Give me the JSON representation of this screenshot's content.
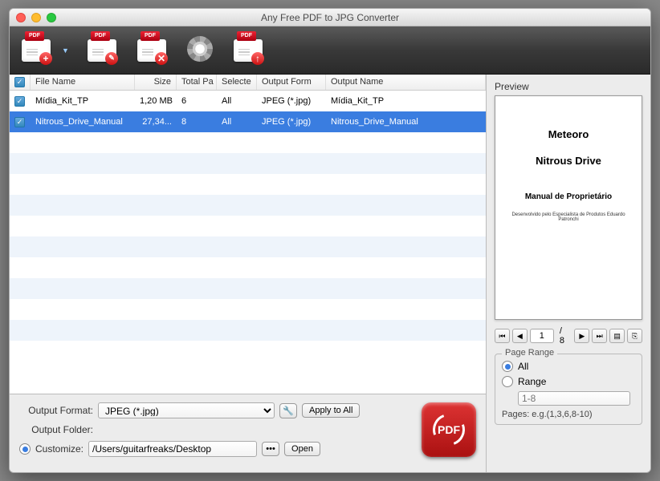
{
  "window": {
    "title": "Any Free PDF to JPG Converter"
  },
  "toolbar": {
    "add_label": "Add PDF",
    "edit_label": "Edit PDF",
    "remove_label": "Remove PDF",
    "settings_label": "Settings",
    "upload_label": "Upload PDF"
  },
  "columns": {
    "file_name": "File Name",
    "size": "Size",
    "total_pages": "Total Pa",
    "selected": "Selecte",
    "output_format": "Output Form",
    "output_name": "Output Name"
  },
  "files": [
    {
      "checked": true,
      "file_name": "Mídia_Kit_TP",
      "size": "1,20 MB",
      "total_pages": "6",
      "selected": "All",
      "output_format": "JPEG (*.jpg)",
      "output_name": "Mídia_Kit_TP"
    },
    {
      "checked": true,
      "file_name": "Nitrous_Drive_Manual",
      "size": "27,34...",
      "total_pages": "8",
      "selected": "All",
      "output_format": "JPEG (*.jpg)",
      "output_name": "Nitrous_Drive_Manual"
    }
  ],
  "output": {
    "format_label": "Output Format:",
    "format_value": "JPEG (*.jpg)",
    "apply_all": "Apply to All",
    "folder_label": "Output Folder:",
    "customize_label": "Customize:",
    "path": "/Users/guitarfreaks/Desktop",
    "browse": "•••",
    "open": "Open",
    "convert": "PDF"
  },
  "preview": {
    "label": "Preview",
    "doc_title1": "Meteoro",
    "doc_title2": "Nitrous Drive",
    "doc_title3": "Manual de Proprietário",
    "doc_sub": "Desenvolvido pelo Especialista de Produtos Eduardo Patronchi",
    "page_current": "1",
    "page_total": "/ 8"
  },
  "page_range": {
    "legend": "Page Range",
    "all": "All",
    "range": "Range",
    "range_placeholder": "1-8",
    "hint": "Pages: e.g.(1,3,6,8-10)"
  }
}
